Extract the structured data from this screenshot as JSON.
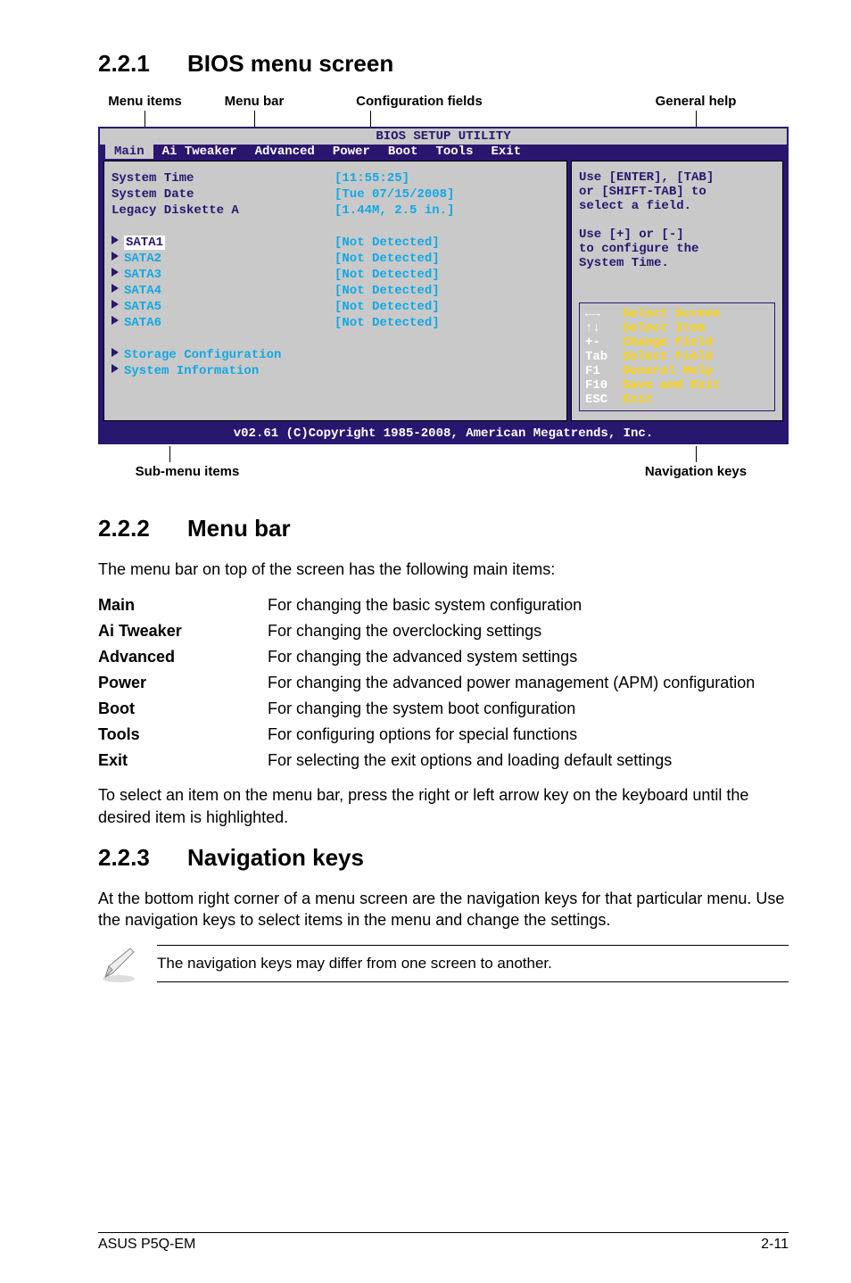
{
  "sections": {
    "s1": {
      "num": "2.2.1",
      "title": "BIOS menu screen"
    },
    "s2": {
      "num": "2.2.2",
      "title": "Menu bar"
    },
    "s3": {
      "num": "2.2.3",
      "title": "Navigation keys"
    }
  },
  "fig_labels": {
    "menu_items": "Menu items",
    "menu_bar": "Menu bar",
    "config_fields": "Configuration fields",
    "general_help": "General help",
    "sub_menu": "Sub-menu items",
    "nav_keys": "Navigation keys"
  },
  "bios": {
    "title": "BIOS SETUP UTILITY",
    "tabs": [
      "Main",
      "Ai Tweaker",
      "Advanced",
      "Power",
      "Boot",
      "Tools",
      "Exit"
    ],
    "left_items": [
      "System Time",
      "System Date",
      "Legacy Diskette A",
      "",
      "SATA1",
      "SATA2",
      "SATA3",
      "SATA4",
      "SATA5",
      "SATA6",
      "",
      "Storage Configuration",
      "System Information"
    ],
    "right_values": [
      "[11:55:25]",
      "[Tue 07/15/2008]",
      "[1.44M, 2.5 in.]",
      "",
      "[Not Detected]",
      "[Not Detected]",
      "[Not Detected]",
      "[Not Detected]",
      "[Not Detected]",
      "[Not Detected]"
    ],
    "help": [
      "Use [ENTER], [TAB]",
      "or [SHIFT-TAB] to",
      "select a field.",
      "",
      "Use [+] or [-]",
      "to configure the",
      "System Time."
    ],
    "nav": [
      {
        "k": "←→",
        "d": "Select Screen"
      },
      {
        "k": "↑↓",
        "d": "Select Item"
      },
      {
        "k": "+-",
        "d": "Change Field"
      },
      {
        "k": "Tab",
        "d": "Select Field"
      },
      {
        "k": "F1",
        "d": "General Help"
      },
      {
        "k": "F10",
        "d": "Save and Exit"
      },
      {
        "k": "ESC",
        "d": "Exit"
      }
    ],
    "footer": "v02.61 (C)Copyright 1985-2008, American Megatrends, Inc."
  },
  "menubar_intro": "The menu bar on top of the screen has the following main items:",
  "defs": [
    {
      "term": "Main",
      "desc": "For changing the basic system configuration"
    },
    {
      "term": "Ai Tweaker",
      "desc": "For changing the overclocking settings"
    },
    {
      "term": "Advanced",
      "desc": "For changing the advanced system settings"
    },
    {
      "term": "Power",
      "desc": "For changing the advanced power management (APM) configuration"
    },
    {
      "term": "Boot",
      "desc": "For changing the system boot configuration"
    },
    {
      "term": "Tools",
      "desc": "For configuring options for special functions"
    },
    {
      "term": "Exit",
      "desc": "For selecting the exit options and loading default settings"
    }
  ],
  "menubar_outro": "To select an item on the menu bar, press the right or left arrow key on the keyboard until the desired item is highlighted.",
  "navkeys_para": "At the bottom right corner of a menu screen are the navigation keys for that particular menu. Use the navigation keys to select items in the menu and change the settings.",
  "note": "The navigation keys may differ from one screen to another.",
  "footer": {
    "left": "ASUS P5Q-EM",
    "right": "2-11"
  }
}
